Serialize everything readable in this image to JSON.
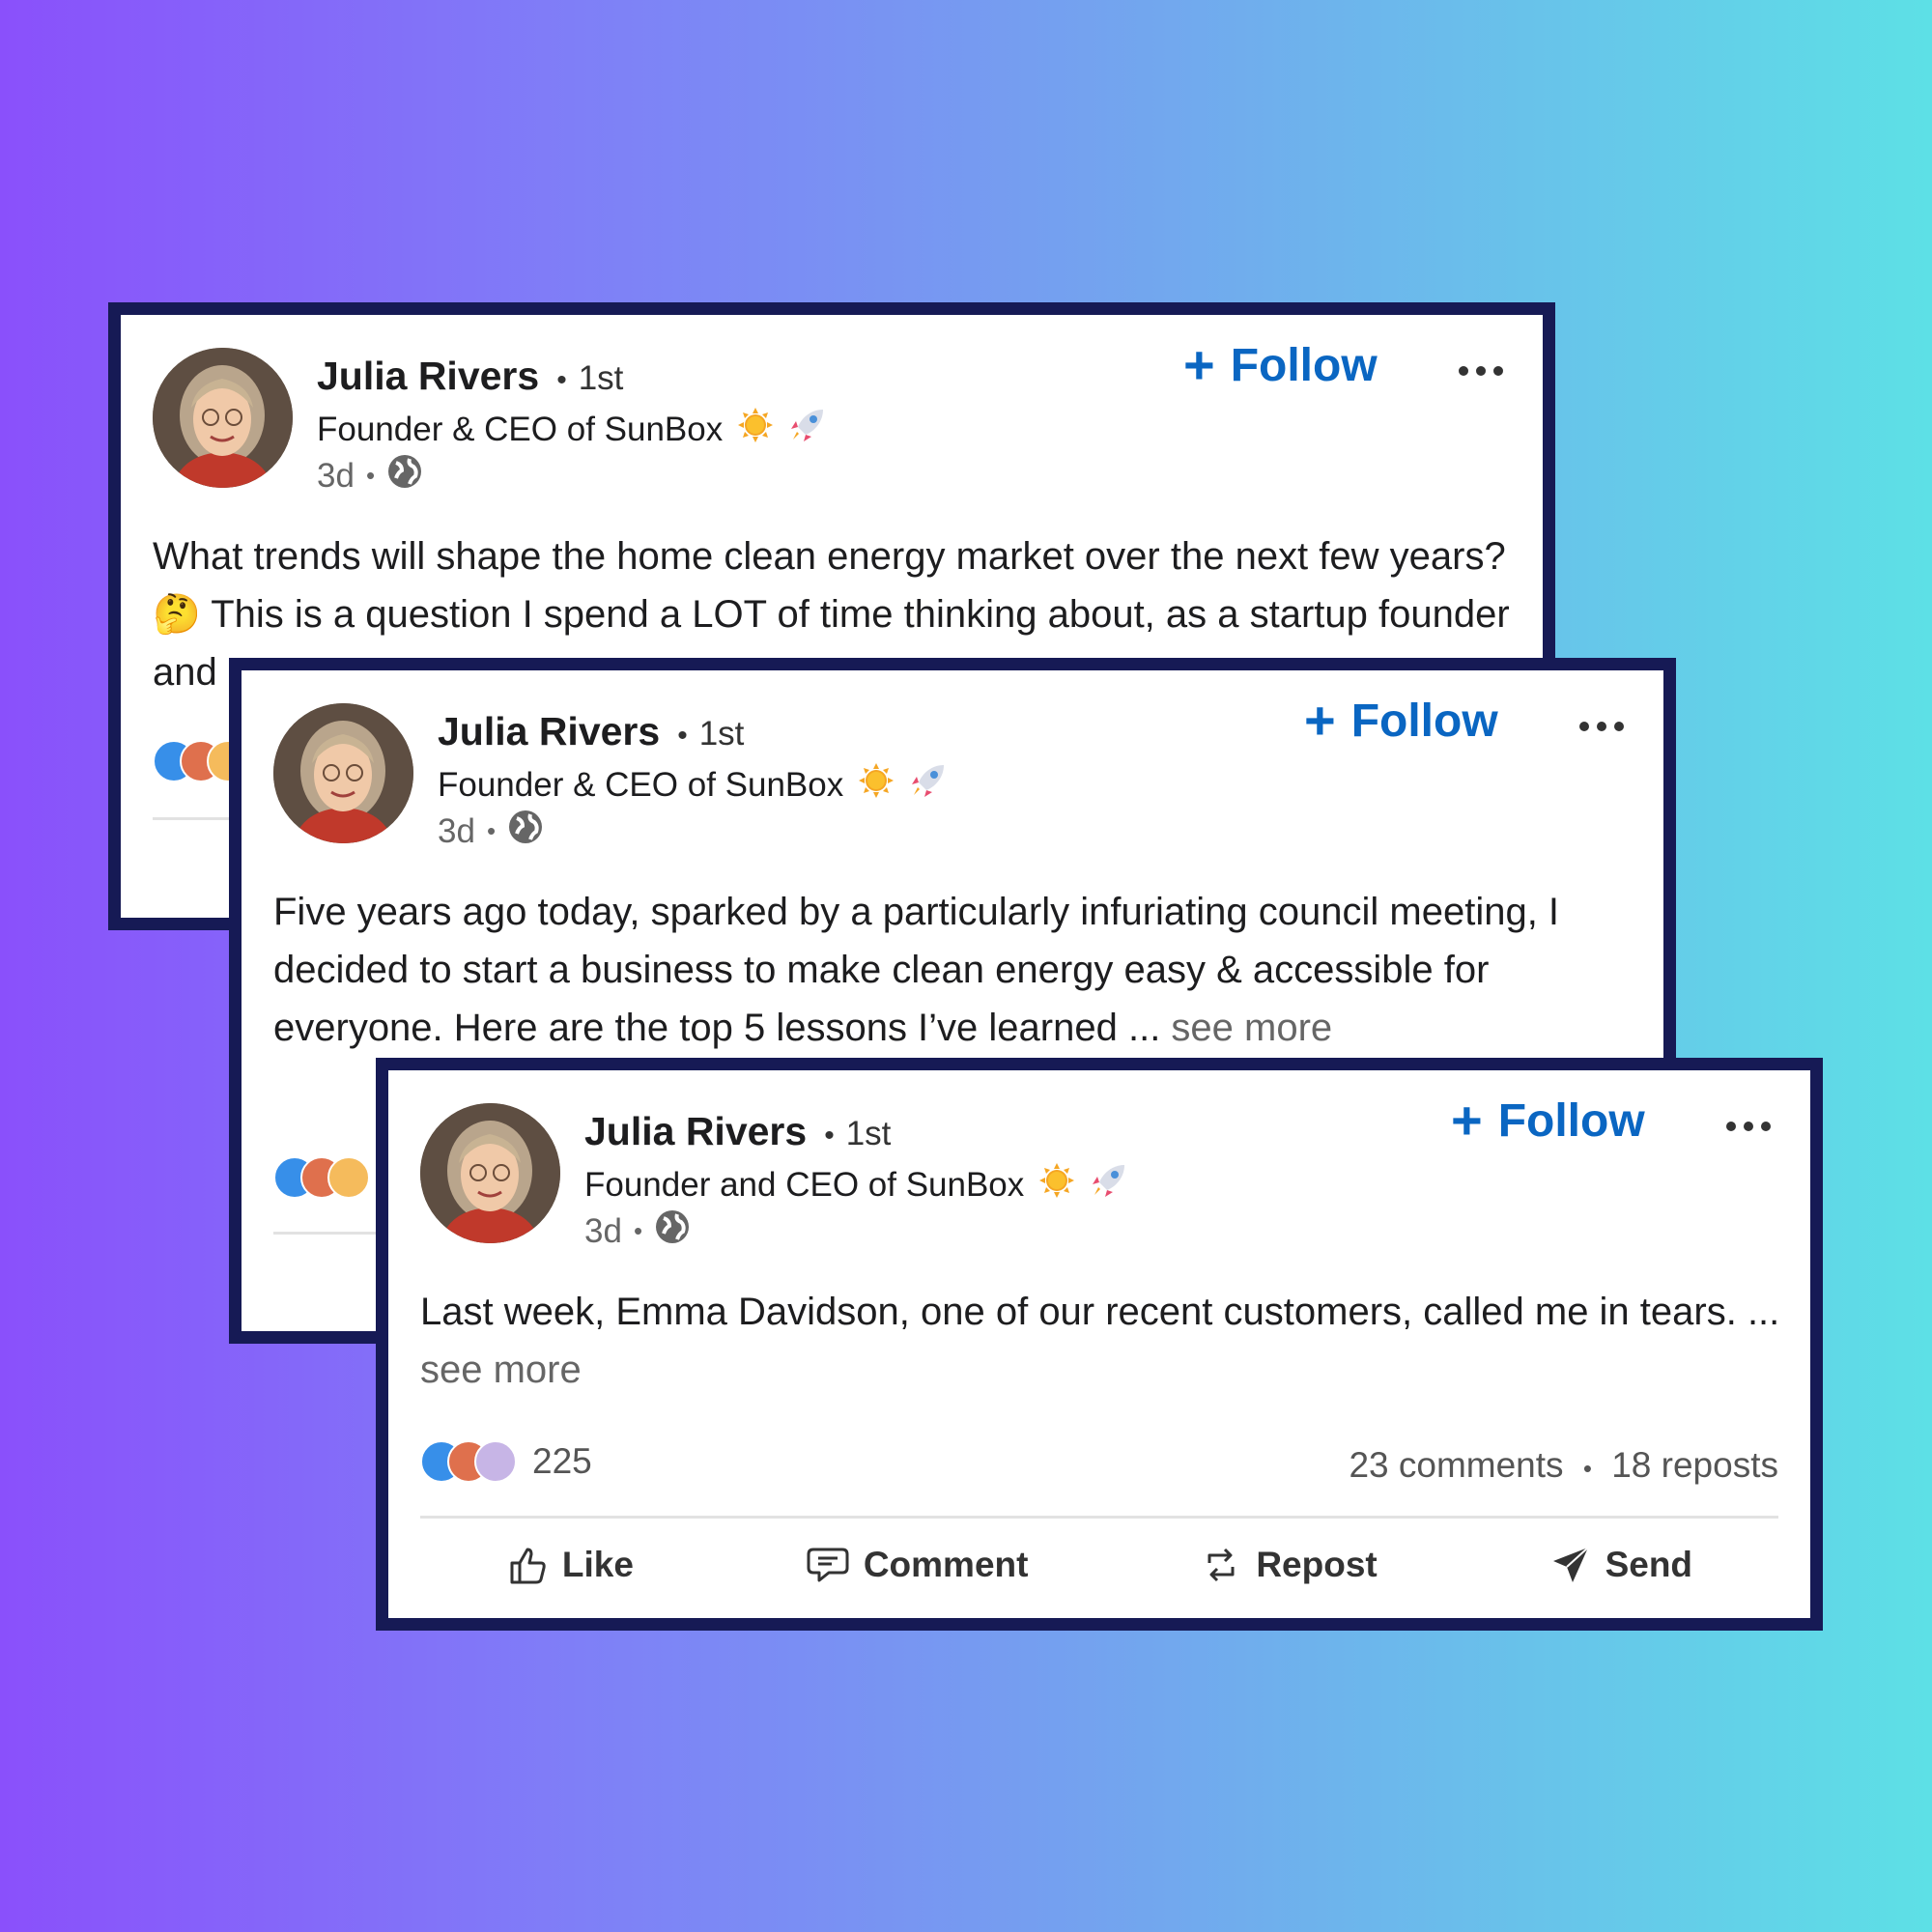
{
  "colors": {
    "accent": "#0a66c2",
    "card_border": "#161a55",
    "gradient_left": "#8a50fb",
    "gradient_right": "#5de0e6"
  },
  "posts": [
    {
      "author": "Julia Rivers",
      "degree": "1st",
      "headline": "Founder & CEO of SunBox",
      "time": "3d",
      "follow_label": "Follow",
      "text": "What trends will shape the home clean energy market over the next few years? 🤔 This is a question I spend a LOT of time thinking about, as a startup founder and "
    },
    {
      "author": "Julia Rivers",
      "degree": "1st",
      "headline": "Founder & CEO of SunBox",
      "time": "3d",
      "follow_label": "Follow",
      "text": "Five years ago today, sparked by a particularly infuriating council meeting, I decided to start a business to make clean energy easy & accessible for everyone. Here are the top 5 lessons I’ve learned ... ",
      "see_more": "see more"
    },
    {
      "author": "Julia Rivers",
      "degree": "1st",
      "headline": "Founder and CEO of SunBox",
      "time": "3d",
      "follow_label": "Follow",
      "text": "Last week, Emma Davidson, one of our recent customers, called me in tears. ... ",
      "see_more": "see more",
      "reaction_count": "225",
      "comments": "23 comments",
      "reposts": "18 reposts",
      "actions": {
        "like": "Like",
        "comment": "Comment",
        "repost": "Repost",
        "send": "Send"
      }
    }
  ]
}
